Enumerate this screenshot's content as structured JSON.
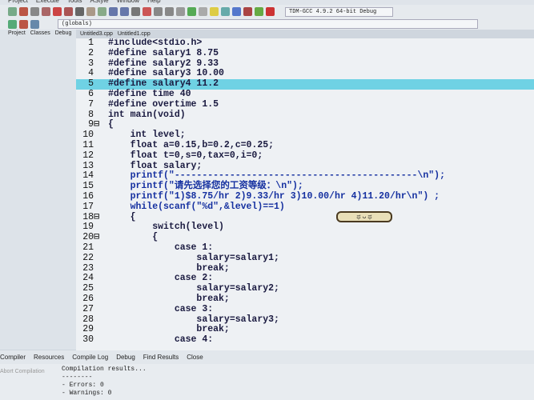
{
  "menu": [
    "Project",
    "Execute",
    "Tools",
    "AStyle",
    "Window",
    "Help"
  ],
  "toolbar": {
    "compiler_select": "TDM-GCC 4.9.2 64-bit Debug",
    "scope_select": "(globals)"
  },
  "left_tabs": [
    "Project",
    "Classes",
    "Debug"
  ],
  "file_tabs": [
    "Untitled3.cpp",
    "Untitled1.cpp"
  ],
  "code_lines": [
    "#include<stdio.h>",
    "#define salary1 8.75",
    "#define salary2 9.33",
    "#define salary3 10.00",
    "#define salary4 11.2",
    "#define time 40",
    "#define overtime 1.5",
    "int main(void)",
    "{",
    "    int level;",
    "    float a=0.15,b=0.2,c=0.25;",
    "    float t=0,s=0,tax=0,i=0;",
    "    float salary;",
    "    printf(\"--------------------------------------------\\n\");",
    "    printf(\"请先选择您的工资等级：\\n\");",
    "    printf(\"1)$8.75/hr 2)9.33/hr 3)10.00/hr 4)11.20/hr\\n\") ;",
    "    while(scanf(\"%d\",&level)==1)",
    "    {",
    "        switch(level)",
    "        {",
    "            case 1:",
    "                salary=salary1;",
    "                break;",
    "            case 2:",
    "                salary=salary2;",
    "                break;",
    "            case 3:",
    "                salary=salary3;",
    "                break;",
    "            case 4:"
  ],
  "highlight_line": 5,
  "fold_lines": [
    9,
    18,
    20
  ],
  "emoji_text": "ಥ ᴗ ಥ",
  "bottom_tabs": [
    "Compiler",
    "Resources",
    "Compile Log",
    "Debug",
    "Find Results",
    "Close"
  ],
  "abort_label": "Abort Compilation",
  "output_lines": [
    "Compilation results...",
    "--------",
    "- Errors: 0",
    "- Warnings: 0"
  ]
}
